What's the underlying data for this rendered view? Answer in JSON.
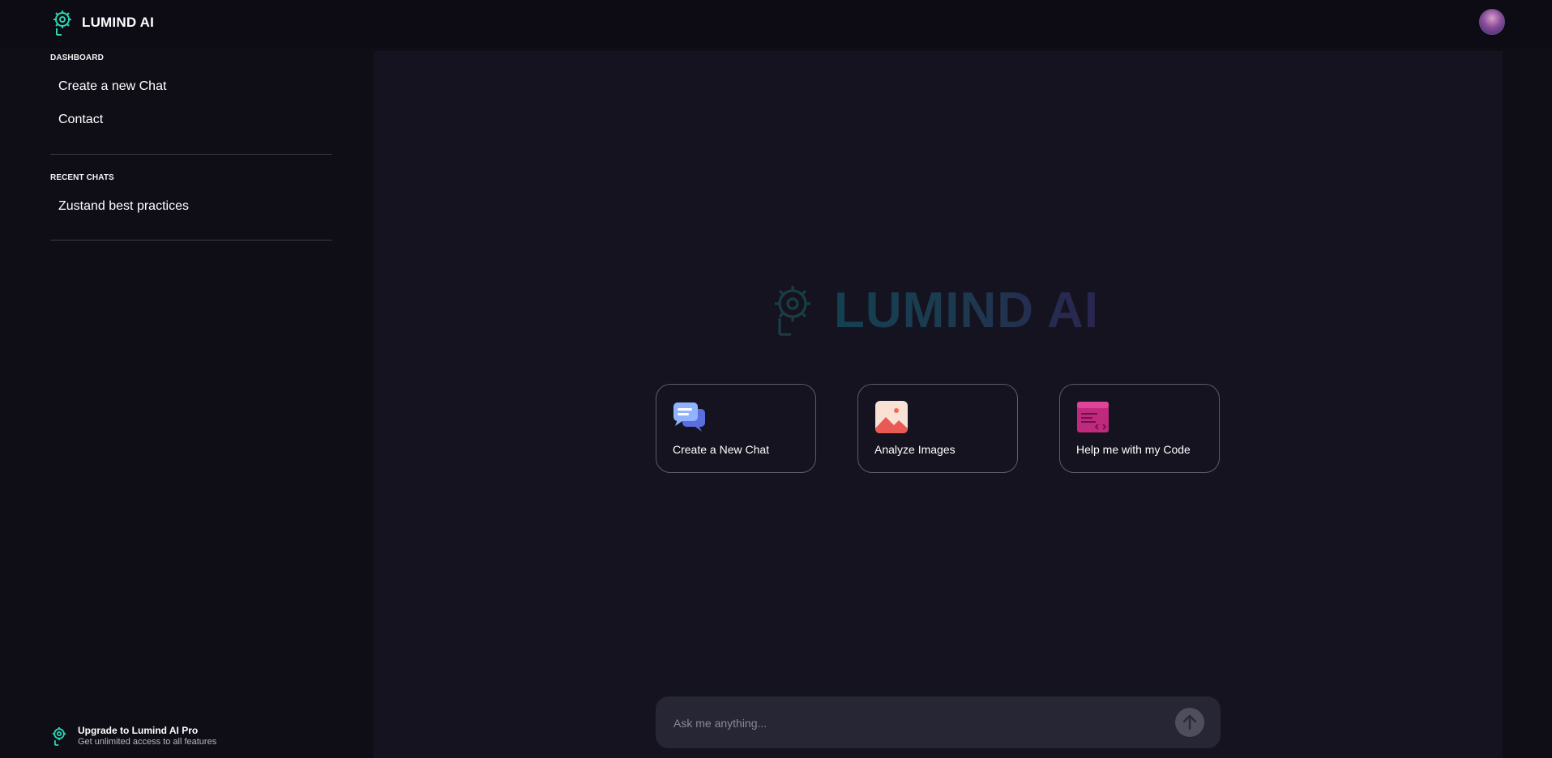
{
  "app": {
    "name": "LUMIND AI",
    "logo_icon": "gear-head-icon",
    "avatar_icon": "user-avatar"
  },
  "sidebar": {
    "dashboard_label": "DASHBOARD",
    "dashboard_items": [
      {
        "label": "Create a new Chat"
      },
      {
        "label": "Contact"
      }
    ],
    "recent_label": "RECENT CHATS",
    "recent_items": [
      {
        "label": "Zustand best practices"
      }
    ],
    "upgrade": {
      "title": "Upgrade to Lumind AI Pro",
      "subtitle": "Get unlimited access to all features"
    }
  },
  "hero": {
    "title": "LUMIND AI"
  },
  "cards": [
    {
      "label": "Create a New Chat",
      "icon": "chat-bubbles-icon"
    },
    {
      "label": "Analyze Images",
      "icon": "image-icon"
    },
    {
      "label": "Help me with my Code",
      "icon": "code-window-icon"
    }
  ],
  "composer": {
    "placeholder": "Ask me anything...",
    "send_icon": "arrow-up-icon"
  },
  "colors": {
    "background": "#0f0e17",
    "main_panel": "#14131f",
    "input_bg": "#272634",
    "accent_teal": "#2bd4b0",
    "card_border": "#5c5b6b"
  }
}
